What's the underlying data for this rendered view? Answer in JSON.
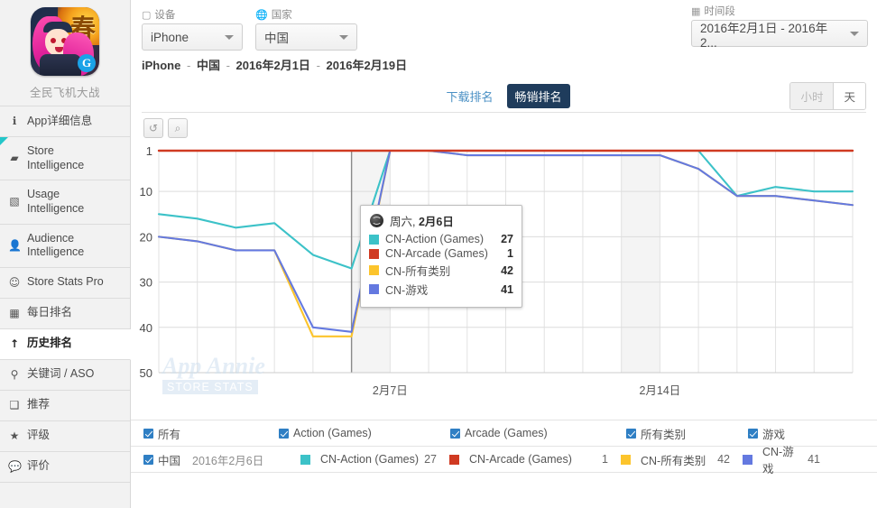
{
  "sidebar": {
    "app_name": "全民飞机大战",
    "app_icon_kanji": "春",
    "app_icon_logo": "G",
    "items": [
      {
        "icon": "info-icon",
        "glyph": "ℹ",
        "label": "App详细信息",
        "active": false,
        "flag": false
      },
      {
        "icon": "store-icon",
        "glyph": "▰",
        "label": "Store\nIntelligence",
        "active": false,
        "flag": true
      },
      {
        "icon": "usage-icon",
        "glyph": "▧",
        "label": "Usage\nIntelligence",
        "active": false,
        "flag": false
      },
      {
        "icon": "audience-icon",
        "glyph": "👤",
        "label": "Audience\nIntelligence",
        "active": false,
        "flag": false
      },
      {
        "icon": "clock-icon",
        "glyph": "☺",
        "label": "Store Stats Pro",
        "active": false,
        "flag": false
      },
      {
        "icon": "calendar-icon",
        "glyph": "▦",
        "label": "每日排名",
        "active": false,
        "flag": false
      },
      {
        "icon": "arrow-up-icon",
        "glyph": "↑",
        "label": "历史排名",
        "active": true,
        "flag": false
      },
      {
        "icon": "keyword-icon",
        "glyph": "⚲",
        "label": "关键词 / ASO",
        "active": false,
        "flag": false
      },
      {
        "icon": "featured-icon",
        "glyph": "❑",
        "label": "推荐",
        "active": false,
        "flag": false
      },
      {
        "icon": "star-icon",
        "glyph": "★",
        "label": "评级",
        "active": false,
        "flag": false
      },
      {
        "icon": "comment-icon",
        "glyph": "💬",
        "label": "评价",
        "active": false,
        "flag": false
      }
    ]
  },
  "filters": {
    "device": {
      "label": "设备",
      "label_icon": "device-icon",
      "value": "iPhone"
    },
    "country": {
      "label": "国家",
      "label_icon": "globe-icon",
      "value": "中国"
    },
    "daterange": {
      "label": "时间段",
      "label_icon": "calendar-icon",
      "value": "2016年2月1日 - 2016年2..."
    }
  },
  "breadcrumb": {
    "device": "iPhone",
    "country": "中国",
    "start": "2016年2月1日",
    "end": "2016年2月19日",
    "sep": "-"
  },
  "tabs": {
    "items": [
      {
        "label": "下载排名",
        "active": false
      },
      {
        "label": "畅销排名",
        "active": true
      }
    ],
    "granularity": [
      {
        "label": "小时",
        "active": false,
        "disabled": true
      },
      {
        "label": "天",
        "active": true,
        "disabled": false
      }
    ]
  },
  "chart_tools": [
    {
      "name": "reset-zoom-button",
      "glyph": "↺"
    },
    {
      "name": "zoom-out-button",
      "glyph": "⌕"
    }
  ],
  "watermark": {
    "line1": "App Annie",
    "line2": "STORE STATS"
  },
  "tooltip": {
    "weekday": "周六,",
    "date": "2月6日",
    "icon": "globe-icon",
    "rows": [
      {
        "name": "CN-Action (Games)",
        "value": "27",
        "color": "#3cc2c8"
      },
      {
        "name": "CN-Arcade (Games)",
        "value": "1",
        "color": "#d03a22"
      },
      {
        "name": "CN-所有类别",
        "value": "42",
        "color": "#fcc42c"
      },
      {
        "name": "CN-游戏",
        "value": "41",
        "color": "#6479e0"
      }
    ]
  },
  "legend_top": [
    {
      "label": "所有",
      "checked": true
    },
    {
      "label": "Action (Games)",
      "checked": true
    },
    {
      "label": "Arcade (Games)",
      "checked": true
    },
    {
      "label": "所有类别",
      "checked": true
    },
    {
      "label": "游戏",
      "checked": true
    }
  ],
  "legend_bottom": {
    "country": "中国",
    "checked": true,
    "date": "2016年2月6日",
    "series": [
      {
        "name": "CN-Action (Games)",
        "value": "27",
        "color": "#3cc2c8"
      },
      {
        "name": "CN-Arcade (Games)",
        "value": "1",
        "color": "#d03a22"
      },
      {
        "name": "CN-所有类别",
        "value": "42",
        "color": "#fcc42c"
      },
      {
        "name": "CN-游戏",
        "value": "41",
        "color": "#6479e0"
      }
    ]
  },
  "chart_data": {
    "type": "line",
    "title": "",
    "xlabel": "",
    "ylabel": "",
    "ylim": [
      1,
      50
    ],
    "y_inverted": true,
    "yticks": [
      1,
      10,
      20,
      30,
      40,
      50
    ],
    "grid": true,
    "legend_position": "bottom",
    "x": [
      "2月1日",
      "2月2日",
      "2月3日",
      "2月4日",
      "2月5日",
      "2月6日",
      "2月7日",
      "2月8日",
      "2月9日",
      "2月10日",
      "2月11日",
      "2月12日",
      "2月13日",
      "2月14日",
      "2月15日",
      "2月16日",
      "2月17日",
      "2月18日",
      "2月19日"
    ],
    "xtick_labels": [
      "2月7日",
      "2月14日"
    ],
    "xtick_indices": [
      6,
      13
    ],
    "weekend_bands": [
      [
        5,
        6
      ],
      [
        12,
        13
      ]
    ],
    "highlight_index": 5,
    "series": [
      {
        "name": "CN-Action (Games)",
        "color": "#3cc2c8",
        "values": [
          15,
          16,
          18,
          17,
          24,
          27,
          1,
          1,
          1,
          1,
          1,
          1,
          1,
          1,
          1,
          11,
          9,
          10,
          10
        ]
      },
      {
        "name": "CN-Arcade (Games)",
        "color": "#d03a22",
        "values": [
          1,
          1,
          1,
          1,
          1,
          1,
          1,
          1,
          1,
          1,
          1,
          1,
          1,
          1,
          1,
          1,
          1,
          1,
          1
        ]
      },
      {
        "name": "CN-所有类别",
        "color": "#fcc42c",
        "values": [
          20,
          21,
          23,
          23,
          42,
          42,
          1,
          1,
          2,
          2,
          2,
          2,
          2,
          2,
          5,
          11,
          11,
          12,
          13
        ]
      },
      {
        "name": "CN-游戏",
        "color": "#6479e0",
        "values": [
          20,
          21,
          23,
          23,
          40,
          41,
          1,
          1,
          2,
          2,
          2,
          2,
          2,
          2,
          5,
          11,
          11,
          12,
          13
        ]
      }
    ]
  }
}
